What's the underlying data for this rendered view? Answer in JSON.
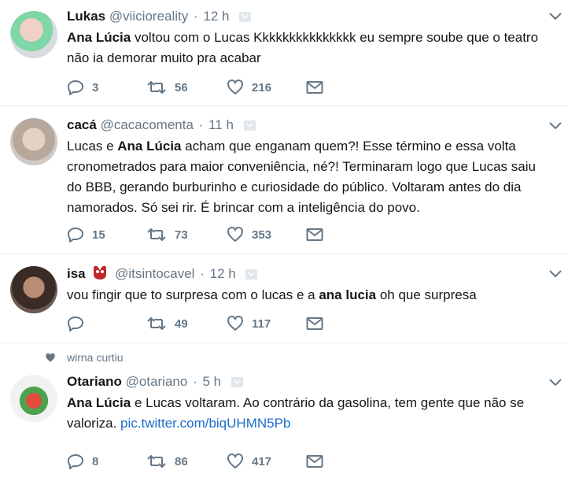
{
  "tweets": [
    {
      "name": "Lukas",
      "handle": "@viicioreality",
      "sep": "·",
      "time": "12 h",
      "text_parts": [
        {
          "bold": "Ana Lúcia"
        },
        {
          "plain": " voltou com o Lucas Kkkkkkkkkkkkkkk eu sempre soube que o teatro não ia demorar muito pra acabar"
        }
      ],
      "replies": "3",
      "retweets": "56",
      "likes": "216"
    },
    {
      "name": "cacá",
      "handle": "@cacacomenta",
      "sep": "·",
      "time": "11 h",
      "text_parts": [
        {
          "plain": "Lucas e "
        },
        {
          "bold": "Ana Lúcia"
        },
        {
          "plain": " acham que enganam quem?! Esse término e essa volta cronometrados para maior conveniência, né?! Terminaram logo que Lucas saiu do BBB, gerando burburinho e curiosidade do público. Voltaram antes do dia namorados. Só sei rir. É brincar com a inteligência do povo."
        }
      ],
      "replies": "15",
      "retweets": "73",
      "likes": "353"
    },
    {
      "name": "isa",
      "handle": "@itsintocavel",
      "sep": "·",
      "time": "12 h",
      "text_parts": [
        {
          "plain": "vou fingir que to surpresa com o lucas e a "
        },
        {
          "bold": "ana lucia"
        },
        {
          "plain": " oh que surpresa"
        }
      ],
      "replies": "",
      "retweets": "49",
      "likes": "117"
    },
    {
      "social_context": "wirna curtiu",
      "name": "Otariano",
      "handle": "@otariano",
      "sep": "·",
      "time": "5 h",
      "text_parts": [
        {
          "bold": "Ana Lúcia"
        },
        {
          "plain": " e Lucas voltaram. Ao contrário da gasolina, tem gente que não se valoriza. "
        },
        {
          "link": "pic.twitter.com/biqUHMN5Pb"
        }
      ],
      "replies": "8",
      "retweets": "86",
      "likes": "417"
    }
  ],
  "colors": {
    "text": "#14171a",
    "secondary": "#657786",
    "link": "#1b6dcc",
    "divider": "#e6ecf0"
  },
  "icons": [
    "reply-icon",
    "retweet-icon",
    "like-icon",
    "direct-message-icon",
    "chevron-down-icon",
    "heart-small-icon"
  ]
}
